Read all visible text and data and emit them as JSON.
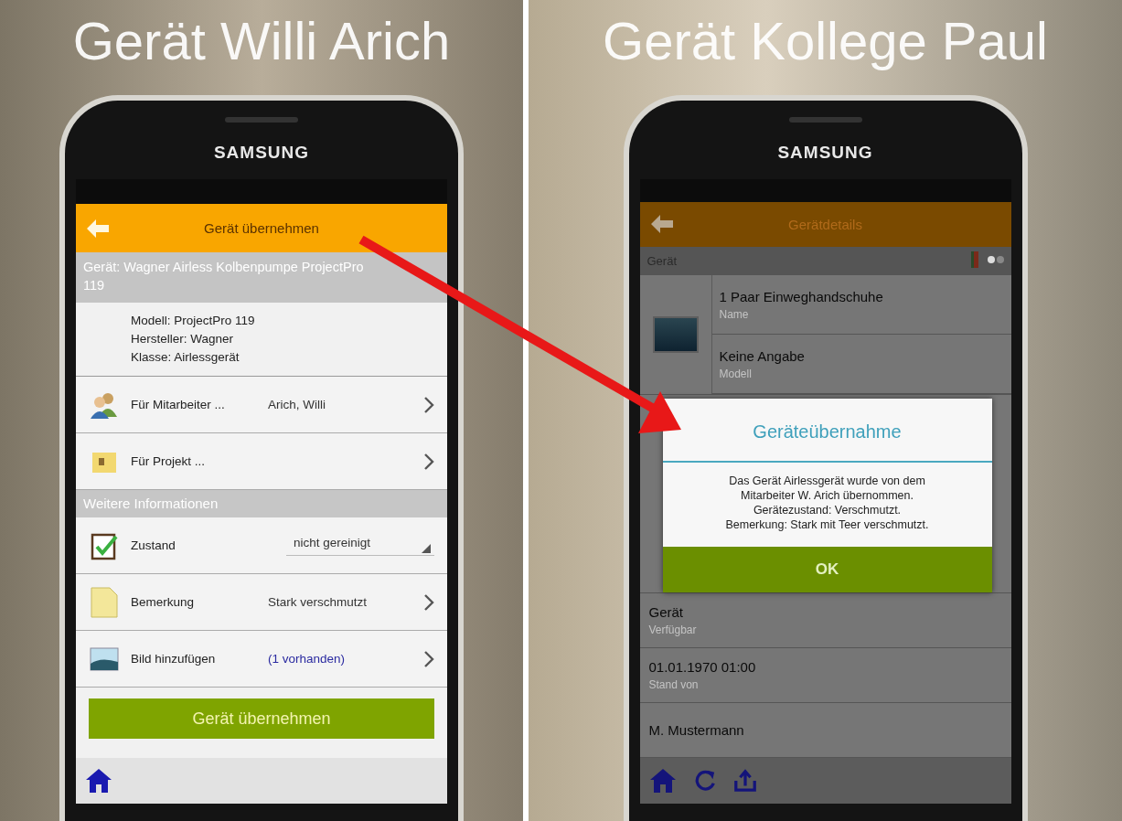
{
  "left": {
    "caption": "Gerät Willi Arich",
    "brand": "SAMSUNG",
    "header": {
      "title": "Gerät übernehmen"
    },
    "device_title": "Gerät: Wagner Airless Kolbenpumpe ProjectPro 119",
    "info_lines": [
      "Modell: ProjectPro 119",
      "Hersteller: Wagner",
      "Klasse: Airlessgerät"
    ],
    "rows": [
      {
        "kind": "link",
        "label": "Für Mitarbeiter ...",
        "value": "Arich, Willi"
      },
      {
        "kind": "link",
        "label": "Für Projekt ..."
      }
    ],
    "section": "Weitere Informationen",
    "more_rows": [
      {
        "kind": "dropdown",
        "label": "Zustand",
        "value": "nicht gereinigt"
      },
      {
        "kind": "link",
        "label": "Bemerkung",
        "value": "Stark verschmutzt"
      },
      {
        "kind": "counter",
        "label": "Bild hinzufügen",
        "value": "(1 vorhanden)"
      }
    ],
    "button": "Gerät übernehmen"
  },
  "right": {
    "caption": "Gerät Kollege Paul",
    "brand": "SAMSUNG",
    "header": {
      "title": "Gerätdetails"
    },
    "section": "Gerät",
    "top_fields": [
      {
        "value": "1 Paar Einweghandschuhe",
        "label": "Name"
      },
      {
        "value": "Keine Angabe",
        "label": "Modell"
      }
    ],
    "fields": [
      {
        "value": "Gerät",
        "label": "Verfügbar"
      },
      {
        "value": "01.01.1970 01:00",
        "label": "Stand von"
      },
      {
        "value": "M. Mustermann"
      }
    ],
    "dialog": {
      "title": "Geräteübernahme",
      "lines": [
        "Das Gerät Airlessgerät wurde von dem",
        "Mitarbeiter W. Arich übernommen.",
        "Gerätezustand: Verschmutzt.",
        "Bemerkung: Stark mit Teer verschmutzt."
      ],
      "button": "OK"
    }
  }
}
